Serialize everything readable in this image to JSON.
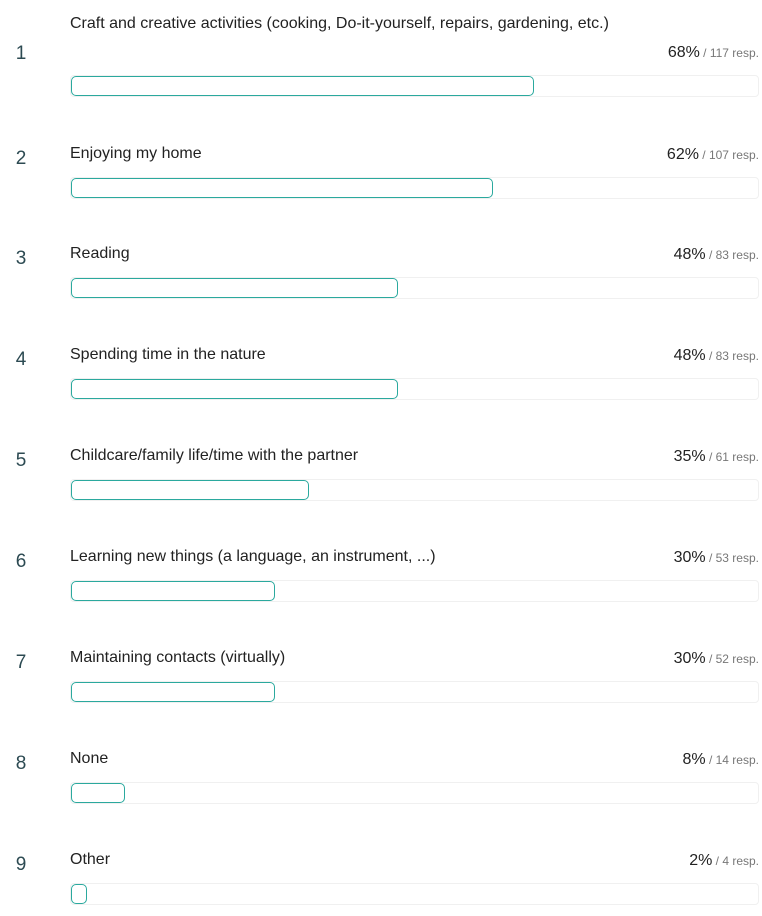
{
  "chart_data": {
    "type": "bar",
    "orientation": "horizontal",
    "resp_suffix": "resp.",
    "xlim": [
      0,
      100
    ],
    "colors": {
      "bar_border": "#2ba99e",
      "track_border": "#f0f0f0",
      "rank_text": "#2c4a52"
    },
    "items": [
      {
        "rank": "1",
        "label": "Craft and creative activities (cooking, Do-it-yourself, repairs, gardening, etc.)",
        "percent": 68,
        "percent_label": "68%",
        "responses": 117
      },
      {
        "rank": "2",
        "label": "Enjoying my home",
        "percent": 62,
        "percent_label": "62%",
        "responses": 107
      },
      {
        "rank": "3",
        "label": "Reading",
        "percent": 48,
        "percent_label": "48%",
        "responses": 83
      },
      {
        "rank": "4",
        "label": "Spending time in the nature",
        "percent": 48,
        "percent_label": "48%",
        "responses": 83
      },
      {
        "rank": "5",
        "label": "Childcare/family life/time with the partner",
        "percent": 35,
        "percent_label": "35%",
        "responses": 61
      },
      {
        "rank": "6",
        "label": "Learning new things (a language, an instrument, ...)",
        "percent": 30,
        "percent_label": "30%",
        "responses": 53
      },
      {
        "rank": "7",
        "label": "Maintaining contacts (virtually)",
        "percent": 30,
        "percent_label": "30%",
        "responses": 52
      },
      {
        "rank": "8",
        "label": "None",
        "percent": 8,
        "percent_label": "8%",
        "responses": 14
      },
      {
        "rank": "9",
        "label": "Other",
        "percent": 2,
        "percent_label": "2%",
        "responses": 4
      }
    ]
  }
}
